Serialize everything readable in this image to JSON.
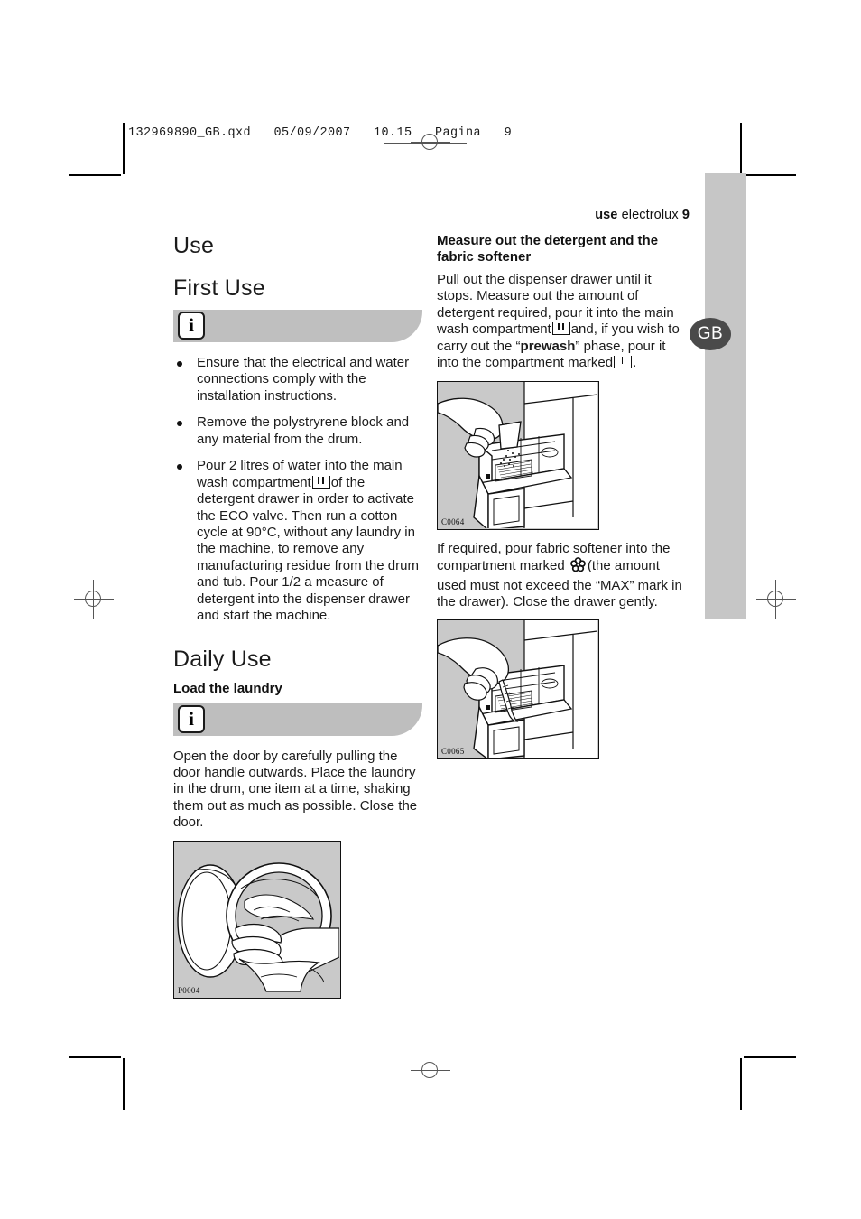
{
  "print_slug": "132969890_GB.qxd   05/09/2007   10.15   Pagina   9",
  "running_head": {
    "bold_prefix": "use",
    "brand": "electrolux",
    "page_number": "9"
  },
  "side_tab": {
    "language_code": "GB"
  },
  "left_column": {
    "title": "Use",
    "subtitle": "First Use",
    "info_icon": "i",
    "bullets": [
      {
        "pre": "Ensure that the electrical and water connections comply with the installation instructions.",
        "glyph": "",
        "post": ""
      },
      {
        "pre": "Remove the polystryrene block and any material from the drum.",
        "glyph": "",
        "post": ""
      },
      {
        "pre": "Pour 2 litres of water into the main wash compartment",
        "glyph": "compartment-main-wash-icon",
        "post": "of the detergent drawer in order to activate the ECO valve. Then run a cotton cycle at 90°C, without any laundry in the machine, to remove any manufacturing residue from the drum and tub. Pour 1/2 a measure of detergent into the dispenser drawer and start the machine."
      }
    ],
    "daily_use_title": "Daily Use",
    "load_laundry_heading": "Load the laundry",
    "load_laundry_body": "Open the door by carefully pulling the door handle outwards. Place the laundry in the drum, one item at a time, shaking them out as much as possible. Close the door.",
    "figure_caption": "P0004"
  },
  "right_column": {
    "heading_line1": "Measure out the detergent and the",
    "heading_line2": "fabric softener",
    "para1_part1": "Pull out the dispenser drawer until it stops. Measure out the amount of detergent required, pour it into the main wash compartment",
    "para1_part2": "and, if you wish to carry out the “",
    "para1_bold": "prewash",
    "para1_part3": "” phase, pour it into the compartment marked",
    "para1_part4": ".",
    "figure1_caption": "C0064",
    "para2_part1": "If required, pour fabric softener into the compartment marked",
    "para2_part2": "(the amount used must not exceed the “MAX” mark in the drawer). Close the drawer gently.",
    "figure2_caption": "C0065"
  },
  "colors": {
    "band_gray": "#bfbfbf",
    "figure_bg": "#c9c9c9",
    "tab_gray": "#c6c6c6",
    "badge_gray": "#4a4a4a",
    "text": "#1b1b1b"
  }
}
